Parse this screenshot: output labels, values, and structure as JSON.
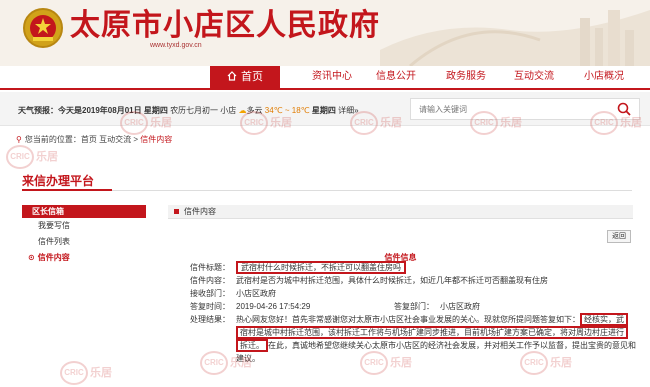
{
  "site": {
    "title": "太原市小店区人民政府",
    "url": "www.tyxd.gov.cn"
  },
  "nav": {
    "items": [
      {
        "label": "首页",
        "active": true
      },
      {
        "label": "资讯中心"
      },
      {
        "label": "信息公开"
      },
      {
        "label": "政务服务"
      },
      {
        "label": "互动交流"
      },
      {
        "label": "小店概况"
      }
    ]
  },
  "infobar": {
    "weather_prefix": "天气预报：今天是",
    "date": "2019年08月01日",
    "weekday": "星期四",
    "lunar": "农历七月初一",
    "district": "小店",
    "condition": "多云",
    "temperature": "34℃ ~ 18℃",
    "weekday2": "星期四",
    "detail_link": "详细»"
  },
  "search": {
    "placeholder": "请输入关键词"
  },
  "breadcrumb": {
    "prefix": "您当前的位置：",
    "items": [
      "首页",
      "互动交流",
      "信件内容"
    ]
  },
  "platform": {
    "title": "来信办理平台"
  },
  "sidebar": {
    "header": "区长信箱",
    "items": [
      {
        "label": "我要写信"
      },
      {
        "label": "信件列表"
      },
      {
        "label": "信件内容",
        "active": true
      }
    ]
  },
  "content": {
    "header": "信件内容",
    "back_button": "返回",
    "section_label": "信件信息",
    "fields": {
      "title_key": "信件标题：",
      "title_value": "武宿村什么时候拆迁，不拆迁可以翻盖住房吗",
      "content_key": "信件内容：",
      "content_value": "武宿村是否为城中村拆迁范围，具体什么时候拆迁，如近几年都不拆迁可否翻盖现有住房",
      "dept_key": "接收部门：",
      "dept_value": "小店区政府",
      "reply_time_key": "答复时间：",
      "reply_time_value": "2019-04-26 17:54:29",
      "reply_dept_key": "答复部门：",
      "reply_dept_value": "小店区政府",
      "result_key": "处理结果：",
      "result_part1": "热心网友您好！首先非常感谢您对太原市小店区社会事业发展的关心。现就您所提问题答复如下：",
      "result_hl1": "经核实，武",
      "result_hl2": "宿村是城中村拆迁范围，该村拆迁工作将与机场扩建同步推进，目前机场扩建方案已确定，将对周边村庄进行",
      "result_hl3": "拆迁。",
      "result_part2": "在此，真诚地希望您继续关心太原市小店区的经济社会发展，并对相关工作予以监督，提出宝贵的意见和建议。"
    }
  },
  "watermark": {
    "logo_text": "CRIC",
    "brand_text": "乐居"
  }
}
